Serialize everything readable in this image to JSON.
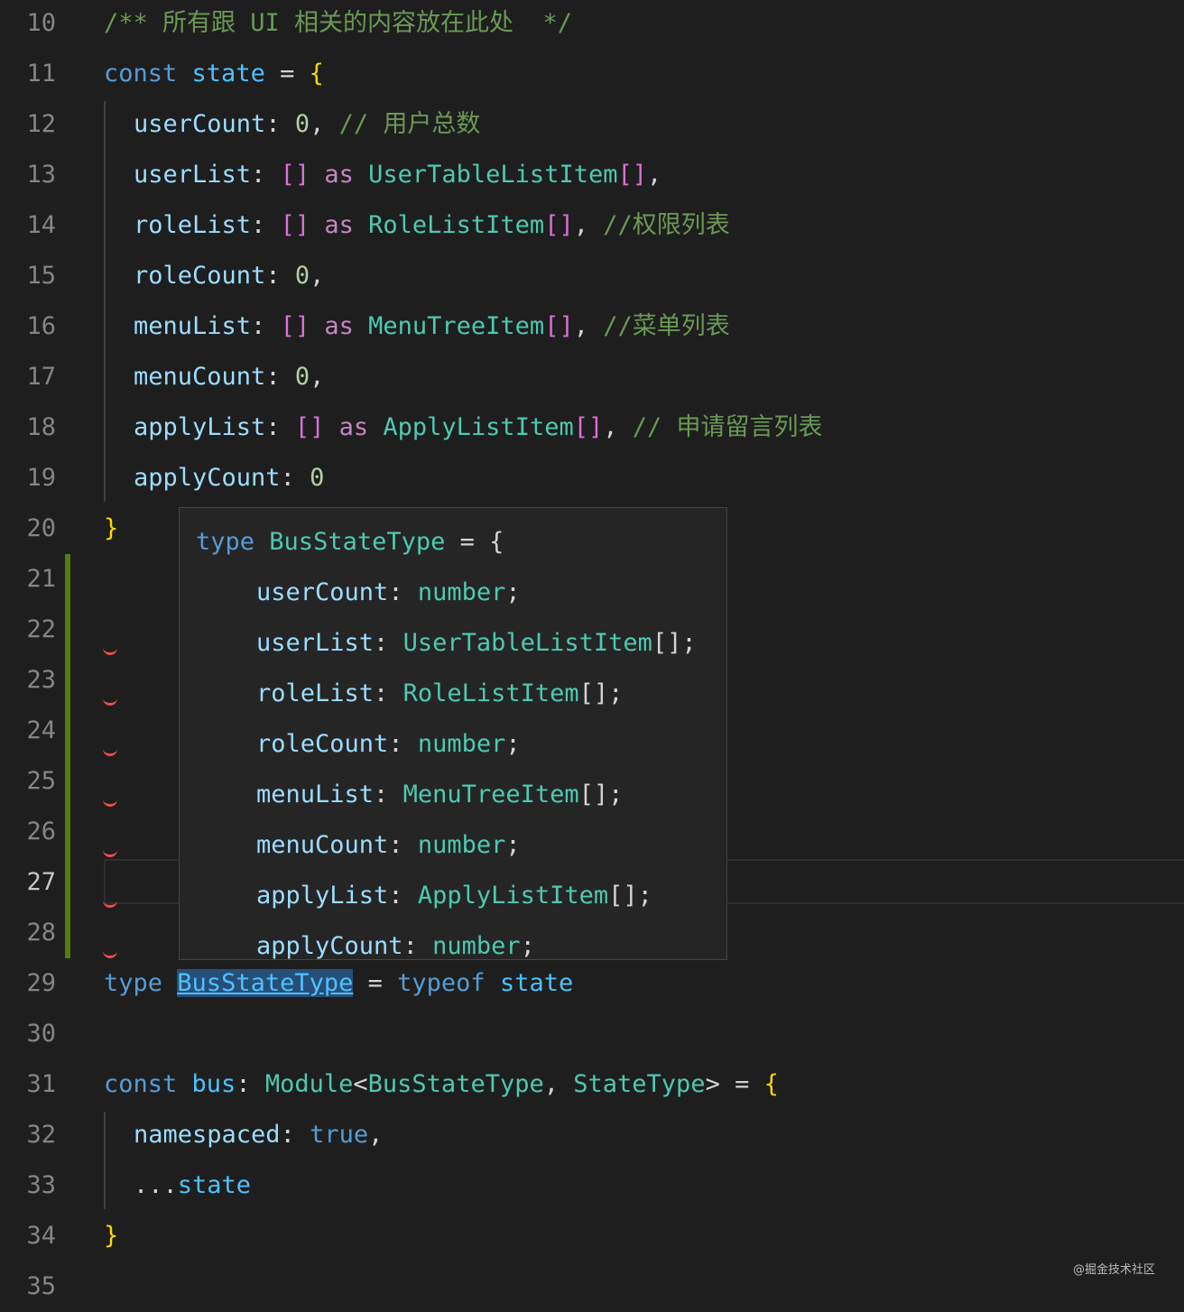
{
  "editor": {
    "lines": [
      {
        "n": "10",
        "tokens": [
          {
            "t": "/** 所有跟 UI 相关的内容放在此处  */",
            "c": "comment"
          }
        ]
      },
      {
        "n": "11",
        "tokens": [
          {
            "t": "const",
            "c": "kw"
          },
          {
            "t": " ",
            "c": "punc"
          },
          {
            "t": "state",
            "c": "var"
          },
          {
            "t": " = ",
            "c": "punc"
          },
          {
            "t": "{",
            "c": "brace"
          }
        ]
      },
      {
        "n": "12",
        "indent": true,
        "tokens": [
          {
            "t": "userCount",
            "c": "prop"
          },
          {
            "t": ": ",
            "c": "punc"
          },
          {
            "t": "0",
            "c": "num"
          },
          {
            "t": ", ",
            "c": "punc"
          },
          {
            "t": "// 用户总数",
            "c": "comment"
          }
        ]
      },
      {
        "n": "13",
        "indent": true,
        "tokens": [
          {
            "t": "userList",
            "c": "prop"
          },
          {
            "t": ": ",
            "c": "punc"
          },
          {
            "t": "[]",
            "c": "brk"
          },
          {
            "t": " ",
            "c": "punc"
          },
          {
            "t": "as",
            "c": "ctl"
          },
          {
            "t": " ",
            "c": "punc"
          },
          {
            "t": "UserTableListItem",
            "c": "type"
          },
          {
            "t": "[]",
            "c": "brk"
          },
          {
            "t": ",",
            "c": "punc"
          }
        ]
      },
      {
        "n": "14",
        "indent": true,
        "tokens": [
          {
            "t": "roleList",
            "c": "prop"
          },
          {
            "t": ": ",
            "c": "punc"
          },
          {
            "t": "[]",
            "c": "brk"
          },
          {
            "t": " ",
            "c": "punc"
          },
          {
            "t": "as",
            "c": "ctl"
          },
          {
            "t": " ",
            "c": "punc"
          },
          {
            "t": "RoleListItem",
            "c": "type"
          },
          {
            "t": "[]",
            "c": "brk"
          },
          {
            "t": ", ",
            "c": "punc"
          },
          {
            "t": "//权限列表",
            "c": "comment"
          }
        ]
      },
      {
        "n": "15",
        "indent": true,
        "tokens": [
          {
            "t": "roleCount",
            "c": "prop"
          },
          {
            "t": ": ",
            "c": "punc"
          },
          {
            "t": "0",
            "c": "num"
          },
          {
            "t": ",",
            "c": "punc"
          }
        ]
      },
      {
        "n": "16",
        "indent": true,
        "tokens": [
          {
            "t": "menuList",
            "c": "prop"
          },
          {
            "t": ": ",
            "c": "punc"
          },
          {
            "t": "[]",
            "c": "brk"
          },
          {
            "t": " ",
            "c": "punc"
          },
          {
            "t": "as",
            "c": "ctl"
          },
          {
            "t": " ",
            "c": "punc"
          },
          {
            "t": "MenuTreeItem",
            "c": "type"
          },
          {
            "t": "[]",
            "c": "brk"
          },
          {
            "t": ", ",
            "c": "punc"
          },
          {
            "t": "//菜单列表",
            "c": "comment"
          }
        ]
      },
      {
        "n": "17",
        "indent": true,
        "tokens": [
          {
            "t": "menuCount",
            "c": "prop"
          },
          {
            "t": ": ",
            "c": "punc"
          },
          {
            "t": "0",
            "c": "num"
          },
          {
            "t": ",",
            "c": "punc"
          }
        ]
      },
      {
        "n": "18",
        "indent": true,
        "tokens": [
          {
            "t": "applyList",
            "c": "prop"
          },
          {
            "t": ": ",
            "c": "punc"
          },
          {
            "t": "[]",
            "c": "brk"
          },
          {
            "t": " ",
            "c": "punc"
          },
          {
            "t": "as",
            "c": "ctl"
          },
          {
            "t": " ",
            "c": "punc"
          },
          {
            "t": "ApplyListItem",
            "c": "type"
          },
          {
            "t": "[]",
            "c": "brk"
          },
          {
            "t": ", ",
            "c": "punc"
          },
          {
            "t": "// 申请留言列表",
            "c": "comment"
          }
        ]
      },
      {
        "n": "19",
        "indent": true,
        "tokens": [
          {
            "t": "applyCount",
            "c": "prop"
          },
          {
            "t": ": ",
            "c": "punc"
          },
          {
            "t": "0",
            "c": "num"
          }
        ]
      },
      {
        "n": "20",
        "tokens": [
          {
            "t": "}",
            "c": "brace"
          }
        ]
      },
      {
        "n": "21",
        "tokens": []
      },
      {
        "n": "22",
        "tokens": []
      },
      {
        "n": "23",
        "tokens": []
      },
      {
        "n": "24",
        "tokens": []
      },
      {
        "n": "25",
        "tokens": []
      },
      {
        "n": "26",
        "tokens": []
      },
      {
        "n": "27",
        "current": true,
        "tokens": []
      },
      {
        "n": "28",
        "tokens": []
      },
      {
        "n": "29",
        "tokens": [
          {
            "t": "type",
            "c": "kw"
          },
          {
            "t": " ",
            "c": "punc"
          },
          {
            "t": "BusStateType",
            "c": "hl"
          },
          {
            "t": " = ",
            "c": "punc"
          },
          {
            "t": "typeof",
            "c": "kw"
          },
          {
            "t": " ",
            "c": "punc"
          },
          {
            "t": "state",
            "c": "var"
          }
        ]
      },
      {
        "n": "30",
        "tokens": []
      },
      {
        "n": "31",
        "tokens": [
          {
            "t": "const",
            "c": "kw"
          },
          {
            "t": " ",
            "c": "punc"
          },
          {
            "t": "bus",
            "c": "var"
          },
          {
            "t": ": ",
            "c": "punc"
          },
          {
            "t": "Module",
            "c": "type"
          },
          {
            "t": "<",
            "c": "punc"
          },
          {
            "t": "BusStateType",
            "c": "type"
          },
          {
            "t": ", ",
            "c": "punc"
          },
          {
            "t": "StateType",
            "c": "type"
          },
          {
            "t": "> = ",
            "c": "punc"
          },
          {
            "t": "{",
            "c": "brace"
          }
        ]
      },
      {
        "n": "32",
        "indent": true,
        "tokens": [
          {
            "t": "namespaced",
            "c": "prop"
          },
          {
            "t": ": ",
            "c": "punc"
          },
          {
            "t": "true",
            "c": "kw"
          },
          {
            "t": ",",
            "c": "punc"
          }
        ]
      },
      {
        "n": "33",
        "indent": true,
        "tokens": [
          {
            "t": "...",
            "c": "punc"
          },
          {
            "t": "state",
            "c": "var"
          }
        ]
      },
      {
        "n": "34",
        "tokens": [
          {
            "t": "}",
            "c": "brace"
          }
        ]
      },
      {
        "n": "35",
        "tokens": []
      }
    ]
  },
  "hover": {
    "header": [
      {
        "t": "type",
        "c": "kw"
      },
      {
        "t": " ",
        "c": "punc"
      },
      {
        "t": "BusStateType",
        "c": "type"
      },
      {
        "t": " = {",
        "c": "punc"
      }
    ],
    "members": [
      [
        {
          "t": "userCount",
          "c": "prop"
        },
        {
          "t": ": ",
          "c": "punc"
        },
        {
          "t": "number",
          "c": "type"
        },
        {
          "t": ";",
          "c": "punc"
        }
      ],
      [
        {
          "t": "userList",
          "c": "prop"
        },
        {
          "t": ": ",
          "c": "punc"
        },
        {
          "t": "UserTableListItem",
          "c": "type"
        },
        {
          "t": "[];",
          "c": "punc"
        }
      ],
      [
        {
          "t": "roleList",
          "c": "prop"
        },
        {
          "t": ": ",
          "c": "punc"
        },
        {
          "t": "RoleListItem",
          "c": "type"
        },
        {
          "t": "[];",
          "c": "punc"
        }
      ],
      [
        {
          "t": "roleCount",
          "c": "prop"
        },
        {
          "t": ": ",
          "c": "punc"
        },
        {
          "t": "number",
          "c": "type"
        },
        {
          "t": ";",
          "c": "punc"
        }
      ],
      [
        {
          "t": "menuList",
          "c": "prop"
        },
        {
          "t": ": ",
          "c": "punc"
        },
        {
          "t": "MenuTreeItem",
          "c": "type"
        },
        {
          "t": "[];",
          "c": "punc"
        }
      ],
      [
        {
          "t": "menuCount",
          "c": "prop"
        },
        {
          "t": ": ",
          "c": "punc"
        },
        {
          "t": "number",
          "c": "type"
        },
        {
          "t": ";",
          "c": "punc"
        }
      ],
      [
        {
          "t": "applyList",
          "c": "prop"
        },
        {
          "t": ": ",
          "c": "punc"
        },
        {
          "t": "ApplyListItem",
          "c": "type"
        },
        {
          "t": "[];",
          "c": "punc"
        }
      ],
      [
        {
          "t": "applyCount",
          "c": "prop"
        },
        {
          "t": ": ",
          "c": "punc"
        },
        {
          "t": "number",
          "c": "type"
        },
        {
          "t": ";",
          "c": "punc"
        }
      ]
    ]
  },
  "watermark": "@掘金技术社区",
  "colors": {
    "background": "#1e1e1e",
    "comment": "#6a9955",
    "keyword": "#569cd6",
    "type": "#4ec9b0",
    "property": "#9cdcfe",
    "git_added": "#587c0c",
    "error_squiggle": "#f14c4c"
  }
}
